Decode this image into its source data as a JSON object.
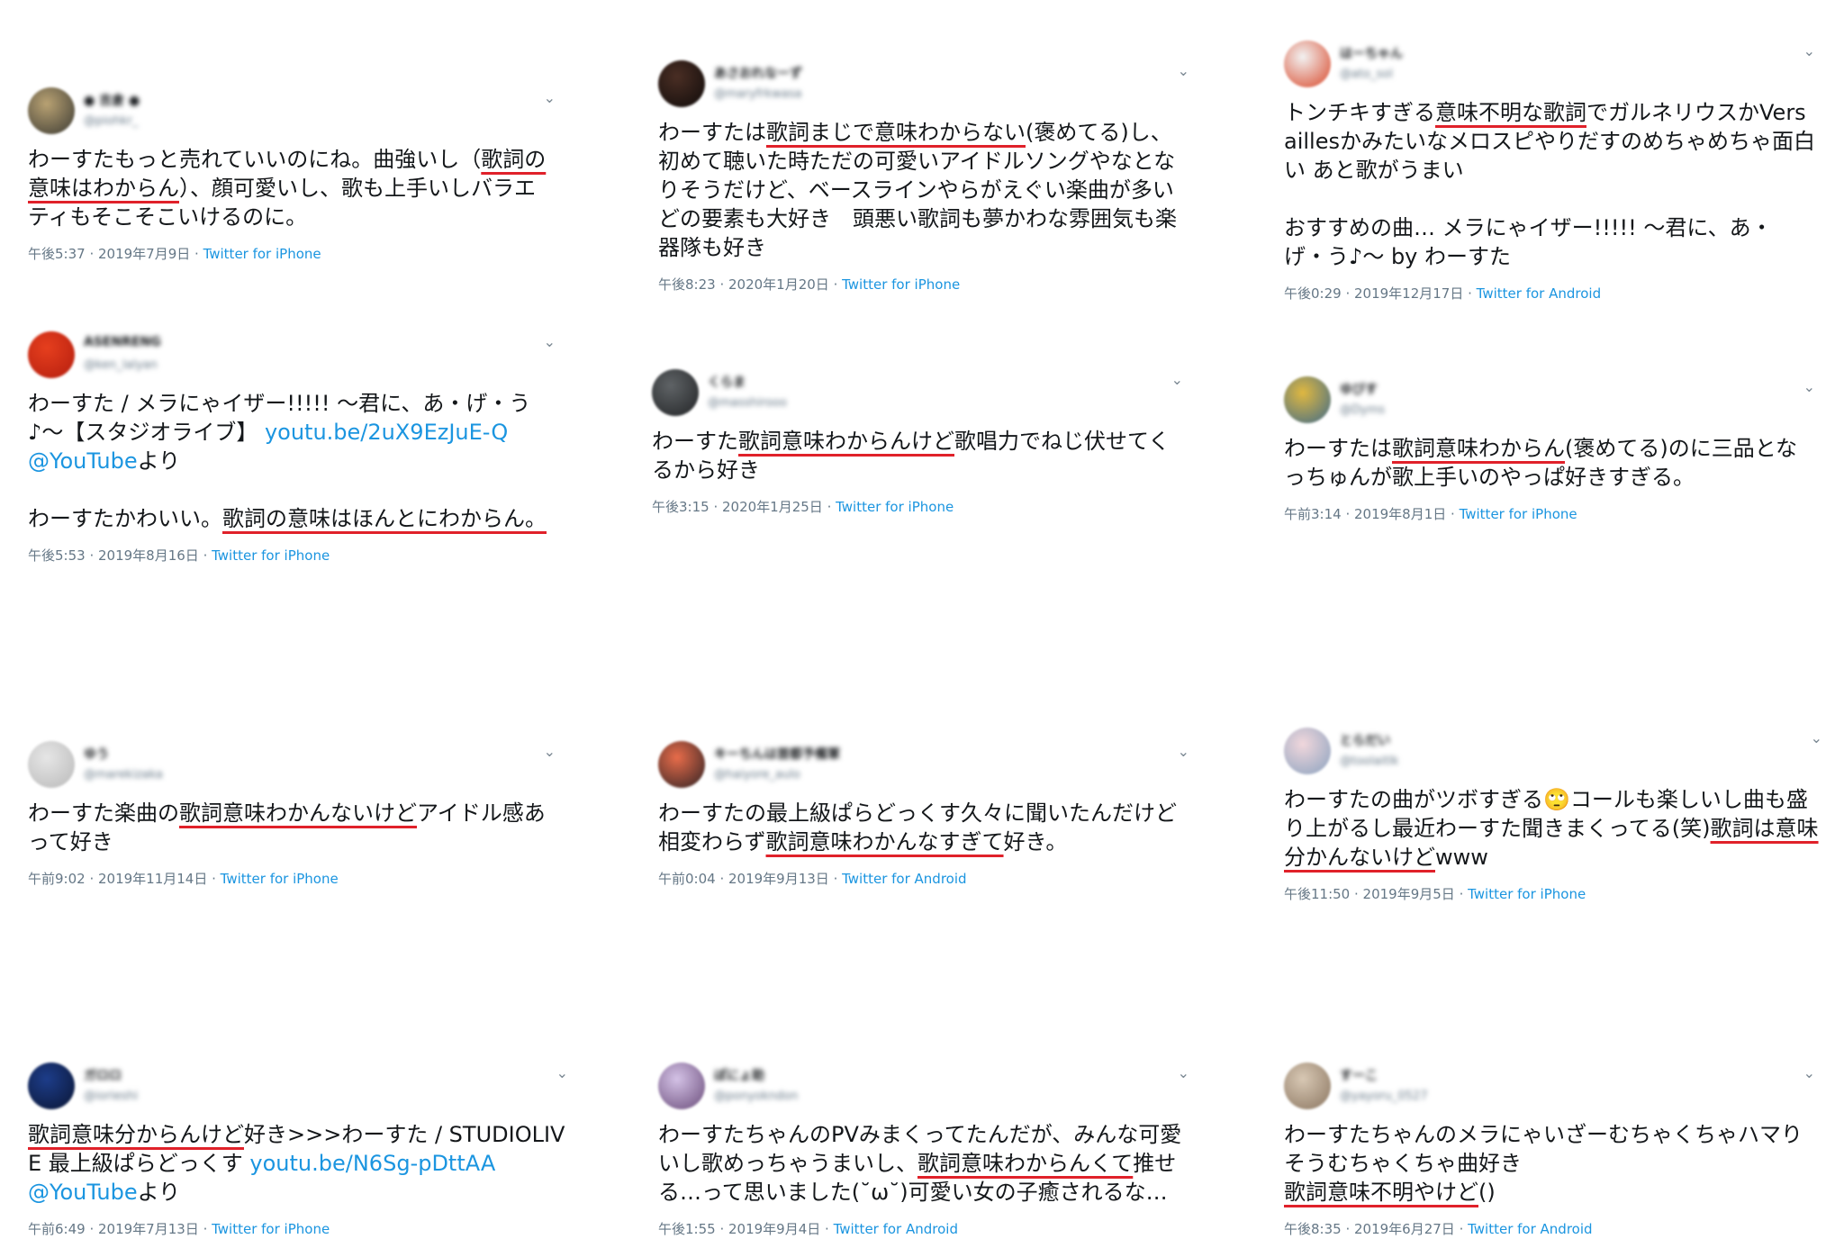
{
  "colors": {
    "text": "#14171a",
    "link": "#1b95e0",
    "meta": "#657786",
    "underline": "#e0212a"
  },
  "icons": {
    "caret": "chevron-down-icon"
  },
  "tweets": [
    {
      "name": "● 吉倉 ●",
      "handle": "@piohkr_",
      "avatar": [
        "#b9a273",
        "#3b3a33"
      ],
      "segments": [
        {
          "t": "わーすたもっと売れていいのにね。曲強いし（"
        },
        {
          "t": "歌詞の意味はわからん",
          "hl": true
        },
        {
          "t": "）、顔可愛いし、歌も上手いしバラエティもそこそこいけるのに。"
        }
      ],
      "time": "午後5:37 · 2019年7月9日",
      "sep": " · ",
      "source": "Twitter for iPhone"
    },
    {
      "name": "あさおれなーず",
      "handle": "@maryfrkwasa",
      "avatar": [
        "#4a2e24",
        "#0f0b0a"
      ],
      "segments": [
        {
          "t": "わーすたは"
        },
        {
          "t": "歌詞まじで意味わからない",
          "hl": true
        },
        {
          "t": "(褒めてる)し、初めて聴いた時ただの可愛いアイドルソングやなとなりそうだけど、ベースラインやらがえぐい楽曲が多い　どの要素も大好き　頭悪い歌詞も夢かわな雰囲気も楽器隊も好き"
        }
      ],
      "time": "午後8:23 · 2020年1月20日",
      "sep": " · ",
      "source": "Twitter for iPhone"
    },
    {
      "name": "はーちゃん",
      "handle": "@ato_sol",
      "avatar": [
        "#f2f2f2",
        "#d9482a"
      ],
      "segments": [
        {
          "t": "トンチキすぎる"
        },
        {
          "t": "意味不明な歌詞",
          "hl": true
        },
        {
          "t": "でガルネリウスかVersaillesかみたいなメロスピやりだすのめちゃめちゃ面白い あと歌がうまい\n\nおすすめの曲… メラにゃイザー!!!!! 〜君に、あ・げ・う♪〜 by わーすた"
        }
      ],
      "time": "午後0:29 · 2019年12月17日",
      "sep": " · ",
      "source": "Twitter for Android"
    },
    {
      "name": "ASENRENG",
      "handle": "@ken_lalyan",
      "avatar": [
        "#e63f1e",
        "#b41d0e"
      ],
      "segments": [
        {
          "t": "わーすた / メラにゃイザー!!!!! 〜君に、あ・げ・う♪〜【スタジオライブ】 "
        },
        {
          "t": "youtu.be/2uX9EzJuE-Q",
          "link": true
        },
        {
          "t": "\n"
        },
        {
          "t": "@YouTube",
          "link": true
        },
        {
          "t": "より\n\nわーすたかわいい。"
        },
        {
          "t": "歌詞の意味はほんとにわからん。",
          "hl": true
        }
      ],
      "time": "午後5:53 · 2019年8月16日",
      "sep": " · ",
      "source": "Twitter for iPhone"
    },
    {
      "name": "くらま",
      "handle": "@masshirooo",
      "avatar": [
        "#5f6366",
        "#222426"
      ],
      "segments": [
        {
          "t": "わーすた"
        },
        {
          "t": "歌詞意味わからんけど",
          "hl": true
        },
        {
          "t": "歌唱力でねじ伏せてくるから好き"
        }
      ],
      "time": "午後3:15 · 2020年1月25日",
      "sep": " · ",
      "source": "Twitter for iPhone"
    },
    {
      "name": "ゆびす",
      "handle": "@Dyms",
      "avatar": [
        "#e0b840",
        "#3d6a8a"
      ],
      "segments": [
        {
          "t": "わーすたは"
        },
        {
          "t": "歌詞意味わからん",
          "hl": true
        },
        {
          "t": "(褒めてる)のに三品となっちゅんが歌上手いのやっぱ好きすぎる。"
        }
      ],
      "time": "午前3:14 · 2019年8月1日",
      "sep": " · ",
      "source": "Twitter for iPhone"
    },
    {
      "name": "ゆう",
      "handle": "@marekizaka",
      "avatar": [
        "#e6e6e6",
        "#b9b9b9"
      ],
      "segments": [
        {
          "t": "わーすた楽曲の"
        },
        {
          "t": "歌詞意味わかんないけど",
          "hl": true
        },
        {
          "t": "アイドル感あって好き"
        }
      ],
      "time": "午前9:02 · 2019年11月14日",
      "sep": " · ",
      "source": "Twitter for iPhone"
    },
    {
      "name": "キーちんは首都予備軍",
      "handle": "@haiyore_aulo",
      "avatar": [
        "#e86c4a",
        "#2e2224"
      ],
      "segments": [
        {
          "t": "わーすたの最上級ぱらどっくす久々に聞いたんだけど相変わらず"
        },
        {
          "t": "歌詞意味わかんなすぎて",
          "hl": true
        },
        {
          "t": "好き。"
        }
      ],
      "time": "午前0:04 · 2019年9月13日",
      "sep": " · ",
      "source": "Twitter for Android"
    },
    {
      "name": "とらだい",
      "handle": "@toolaitlk",
      "avatar": [
        "#f1d7dc",
        "#8aa2bf"
      ],
      "segments": [
        {
          "t": "わーすたの曲がツボすぎる🙄コールも楽しいし曲も盛り上がるし最近わーすた聞きまくってる(笑)"
        },
        {
          "t": "歌詞は意味分かんないけど",
          "hl": true
        },
        {
          "t": "www"
        }
      ],
      "time": "午後11:50 · 2019年9月5日",
      "sep": " · ",
      "source": "Twitter for iPhone"
    },
    {
      "name": "ガロロ",
      "handle": "@iorieshi",
      "avatar": [
        "#1d3d8a",
        "#0a1533"
      ],
      "segments": [
        {
          "t": "歌詞意味分からんけど",
          "hl": true
        },
        {
          "t": "好き>>>わーすた / STUDIOLIVE 最上級ぱらどっくす "
        },
        {
          "t": "youtu.be/N6Sg-pDttAA",
          "link": true
        },
        {
          "t": "\n"
        },
        {
          "t": "@YouTube",
          "link": true
        },
        {
          "t": "より"
        }
      ],
      "time": "午前6:49 · 2019年7月13日",
      "sep": " · ",
      "source": "Twitter for iPhone"
    },
    {
      "name": "ぽにょ助",
      "handle": "@ponyokndon",
      "avatar": [
        "#d4c2e6",
        "#6a4c7a"
      ],
      "segments": [
        {
          "t": "わーすたちゃんのPVみまくってたんだが、みんな可愛いし歌めっちゃうまいし、"
        },
        {
          "t": "歌詞意味わからんくて",
          "hl": true
        },
        {
          "t": "推せる…って思いました(˘ω˘)可愛い女の子癒されるな…"
        }
      ],
      "time": "午後1:55 · 2019年9月4日",
      "sep": " · ",
      "source": "Twitter for Android"
    },
    {
      "name": "すーこ",
      "handle": "@yayoru_0527",
      "avatar": [
        "#d8c8b4",
        "#8a7560"
      ],
      "segments": [
        {
          "t": "わーすたちゃんのメラにゃいざーむちゃくちゃハマりそうむちゃくちゃ曲好き\n"
        },
        {
          "t": "歌詞意味不明やけど",
          "hl": true
        },
        {
          "t": "()"
        }
      ],
      "time": "午後8:35 · 2019年6月27日",
      "sep": " · ",
      "source": "Twitter for Android"
    }
  ]
}
